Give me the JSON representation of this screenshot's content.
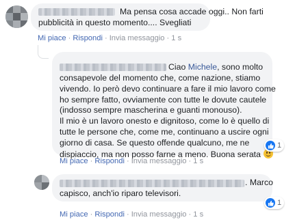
{
  "comments": [
    {
      "text_line1": "Ma pensa cosa accade oggi.. Non farti",
      "text_line2": "pubblicità in questo momento.... Svegliati",
      "actions": {
        "like": "Mi piace",
        "reply": "Rispondi",
        "sent": "Invia messaggio",
        "time": "1 s"
      }
    },
    {
      "greeting": "Ciao ",
      "mention": "Michele",
      "text_line1_rest": ", sono molto",
      "lines": [
        "consapevole del momento che, come nazione, stiamo",
        "vivendo. Io però devo continuare a fare il mio lavoro come",
        "ho sempre fatto, ovviamente con tutte le dovute cautele",
        "(indosso sempre mascherina e guanti monouso).",
        "Il mio è un lavoro onesto e dignitoso, come lo è quello di",
        "tutte le persone che, come me, continuano a uscire ogni",
        "giorno di casa. Se questo offende qualcuno, me ne"
      ],
      "last_line": "dispiaccio, ma non posso farne a meno. Buona serata",
      "reaction_count": "1",
      "actions": {
        "like": "Mi piace",
        "reply": "Rispondi",
        "sent": "Invia messaggio",
        "time": "1 s"
      }
    },
    {
      "text_line1_tail": ". Marco",
      "text_line2": "capisco, anch'io riparo televisori.",
      "reaction_count": "1",
      "actions": {
        "like": "Mi piace",
        "reply": "Rispondi",
        "sent": "Invia messaggio",
        "time": "1 s"
      }
    }
  ],
  "separator": "·",
  "colors": {
    "link": "#4267b2",
    "meta": "#90949c",
    "bubble": "#f2f3f5",
    "like": "#1877f2",
    "mention": "#385898"
  }
}
